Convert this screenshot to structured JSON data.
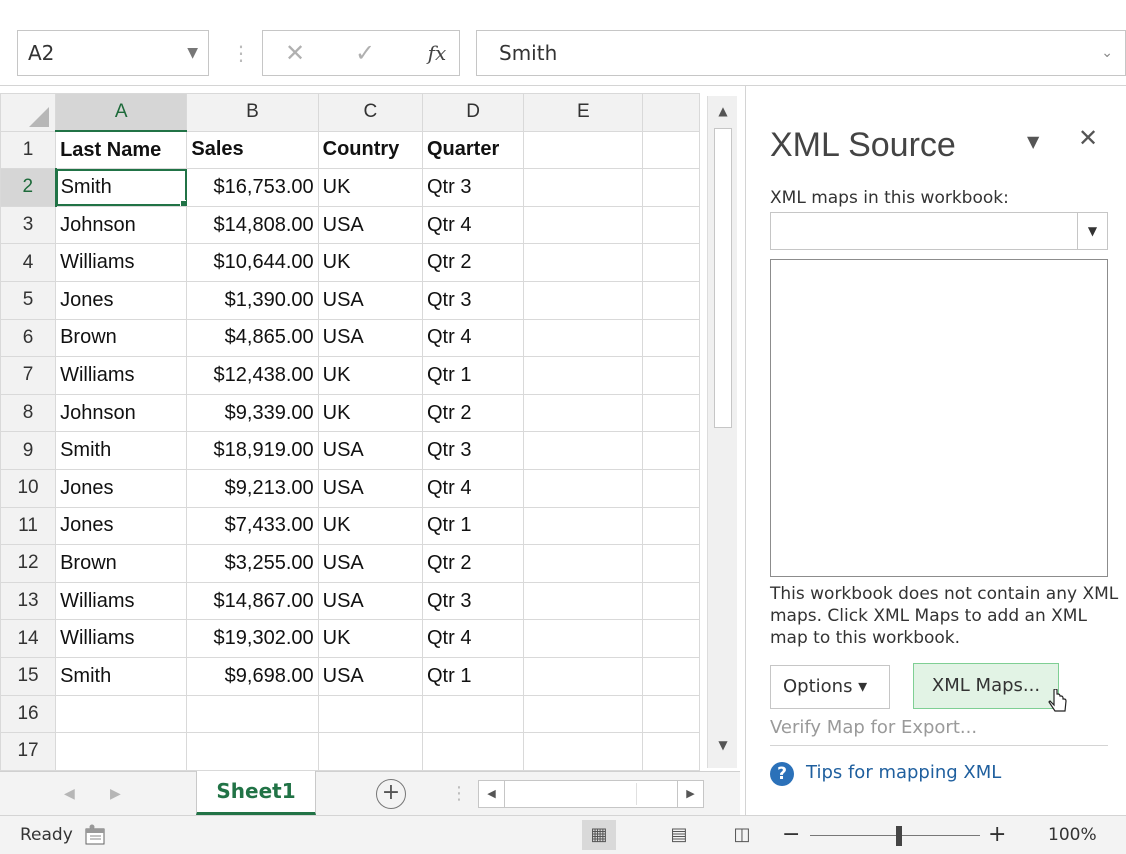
{
  "formula_bar": {
    "name_box": "A2",
    "cancel_glyph": "✕",
    "enter_glyph": "✓",
    "fx_label": "fx",
    "formula": "Smith"
  },
  "columns": [
    "A",
    "B",
    "C",
    "D",
    "E"
  ],
  "rows": [
    {
      "n": "1",
      "a": "Last Name",
      "b": "Sales",
      "c": "Country",
      "d": "Quarter"
    },
    {
      "n": "2",
      "a": "Smith",
      "b": "$16,753.00",
      "c": "UK",
      "d": "Qtr 3"
    },
    {
      "n": "3",
      "a": "Johnson",
      "b": "$14,808.00",
      "c": "USA",
      "d": "Qtr 4"
    },
    {
      "n": "4",
      "a": "Williams",
      "b": "$10,644.00",
      "c": "UK",
      "d": "Qtr 2"
    },
    {
      "n": "5",
      "a": "Jones",
      "b": "$1,390.00",
      "c": "USA",
      "d": "Qtr 3"
    },
    {
      "n": "6",
      "a": "Brown",
      "b": "$4,865.00",
      "c": "USA",
      "d": "Qtr 4"
    },
    {
      "n": "7",
      "a": "Williams",
      "b": "$12,438.00",
      "c": "UK",
      "d": "Qtr 1"
    },
    {
      "n": "8",
      "a": "Johnson",
      "b": "$9,339.00",
      "c": "UK",
      "d": "Qtr 2"
    },
    {
      "n": "9",
      "a": "Smith",
      "b": "$18,919.00",
      "c": "USA",
      "d": "Qtr 3"
    },
    {
      "n": "10",
      "a": "Jones",
      "b": "$9,213.00",
      "c": "USA",
      "d": "Qtr 4"
    },
    {
      "n": "11",
      "a": "Jones",
      "b": "$7,433.00",
      "c": "UK",
      "d": "Qtr 1"
    },
    {
      "n": "12",
      "a": "Brown",
      "b": "$3,255.00",
      "c": "USA",
      "d": "Qtr 2"
    },
    {
      "n": "13",
      "a": "Williams",
      "b": "$14,867.00",
      "c": "USA",
      "d": "Qtr 3"
    },
    {
      "n": "14",
      "a": "Williams",
      "b": "$19,302.00",
      "c": "UK",
      "d": "Qtr 4"
    },
    {
      "n": "15",
      "a": "Smith",
      "b": "$9,698.00",
      "c": "USA",
      "d": "Qtr 1"
    },
    {
      "n": "16",
      "a": "",
      "b": "",
      "c": "",
      "d": ""
    },
    {
      "n": "17",
      "a": "",
      "b": "",
      "c": "",
      "d": ""
    }
  ],
  "tabs": {
    "active_sheet": "Sheet1",
    "add_glyph": "+"
  },
  "pane": {
    "title": "XML Source",
    "maps_label": "XML maps in this workbook:",
    "message": "This workbook does not contain any XML maps. Click XML Maps to add an XML map to this workbook.",
    "options_label": "Options ▾",
    "xml_maps_label": "XML Maps...",
    "verify_label": "Verify Map for Export...",
    "tips_label": "Tips for mapping XML"
  },
  "status": {
    "ready": "Ready",
    "zoom": "100%"
  },
  "colors": {
    "accent": "#217346",
    "link": "#1f5f9e",
    "button_highlight": "#e2f3e5"
  },
  "icons": [
    "dropdown-arrow-icon",
    "cancel-icon",
    "enter-icon",
    "function-icon",
    "expand-icon",
    "add-sheet-icon",
    "help-icon",
    "close-icon",
    "normal-view-icon",
    "page-layout-icon",
    "page-break-icon",
    "macro-record-icon"
  ]
}
